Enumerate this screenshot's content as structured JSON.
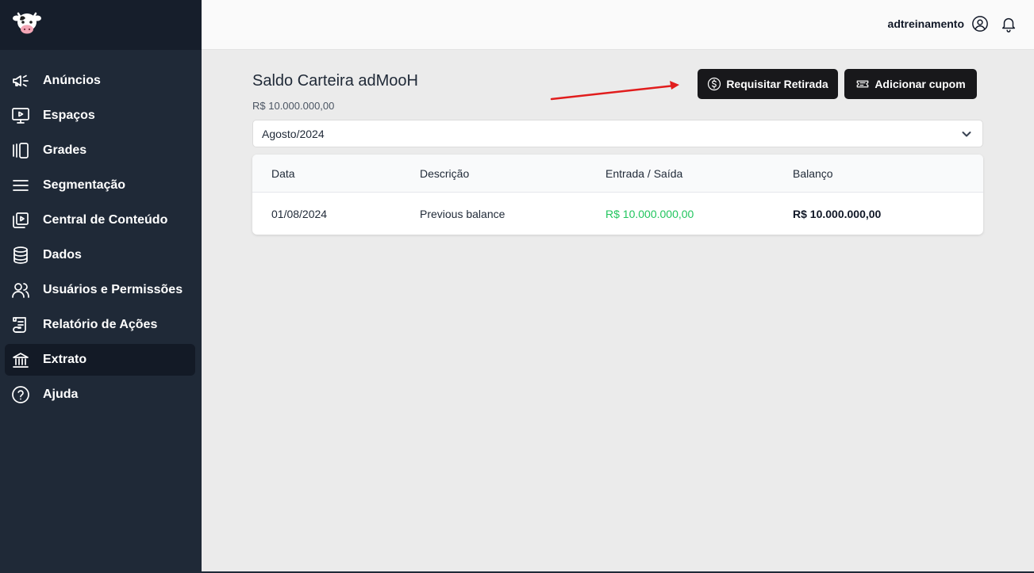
{
  "user": {
    "name": "adtreinamento"
  },
  "sidebar": {
    "items": [
      {
        "label": "Anúncios",
        "icon": "megaphone-icon"
      },
      {
        "label": "Espaços",
        "icon": "monitor-play-icon"
      },
      {
        "label": "Grades",
        "icon": "columns-icon"
      },
      {
        "label": "Segmentação",
        "icon": "menu-lines-icon"
      },
      {
        "label": "Central de Conteúdo",
        "icon": "media-library-icon"
      },
      {
        "label": "Dados",
        "icon": "database-icon"
      },
      {
        "label": "Usuários e Permissões",
        "icon": "users-icon"
      },
      {
        "label": "Relatório de Ações",
        "icon": "scroll-icon"
      },
      {
        "label": "Extrato",
        "icon": "bank-icon",
        "active": true
      },
      {
        "label": "Ajuda",
        "icon": "help-circle-icon"
      }
    ]
  },
  "main": {
    "title": "Saldo Carteira adMooH",
    "balance": "R$ 10.000.000,00",
    "buttons": {
      "withdraw": "Requisitar Retirada",
      "coupon": "Adicionar cupom"
    },
    "month_select": {
      "value": "Agosto/2024"
    },
    "table": {
      "headers": [
        "Data",
        "Descrição",
        "Entrada / Saída",
        "Balanço"
      ],
      "rows": [
        {
          "date": "01/08/2024",
          "description": "Previous balance",
          "amount": "R$ 10.000.000,00",
          "balance": "R$ 10.000.000,00"
        }
      ]
    }
  },
  "colors": {
    "sidebar_bg": "#1f2937",
    "button_bg": "#18181b",
    "positive": "#22c55e",
    "arrow": "#e11d1d"
  }
}
